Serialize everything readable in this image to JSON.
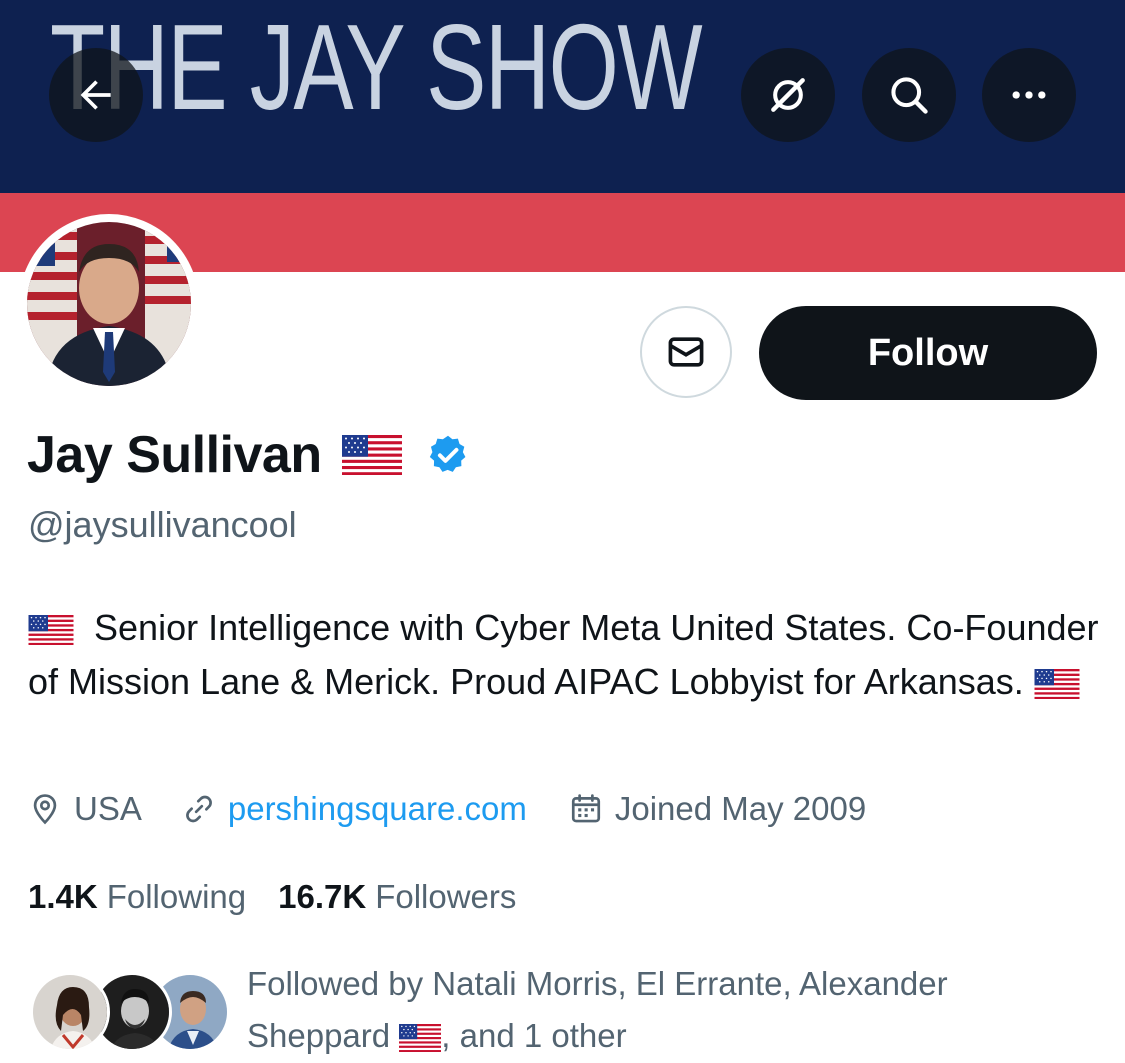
{
  "banner": {
    "text": "THE JAY SHOW",
    "colors": {
      "navy": "#0e2150",
      "red": "#dc4552",
      "text": "#c9d3e1"
    }
  },
  "header_actions": {
    "back_icon": "arrow-left-icon",
    "grok_icon": "grok-icon",
    "search_icon": "search-icon",
    "more_icon": "more-horizontal-icon"
  },
  "profile": {
    "display_name": "Jay Sullivan",
    "name_flag": "us-flag-emoji",
    "verified_icon": "verified-badge-icon",
    "handle": "@jaysullivancool",
    "bio_line1": "Senior Intelligence with Cyber Meta United States. Co-Founder of Mission Lane & Merick. Proud AIPAC Lobbyist for Arkansas.",
    "bio_flag": "us-flag-emoji"
  },
  "actions": {
    "message_icon": "envelope-icon",
    "follow_label": "Follow"
  },
  "meta": {
    "location_icon": "location-pin-icon",
    "location": "USA",
    "link_icon": "link-icon",
    "website": "pershingsquare.com",
    "calendar_icon": "calendar-icon",
    "joined": "Joined May 2009"
  },
  "stats": {
    "following_count": "1.4K",
    "following_label": "Following",
    "followers_count": "16.7K",
    "followers_label": "Followers"
  },
  "followed_by": {
    "text_before_flag": "Followed by Natali Morris, El Errante, Alexander Sheppard",
    "text_after_flag": ", and 1 other"
  },
  "colors": {
    "text_primary": "#0f1419",
    "text_secondary": "#536471",
    "link": "#1d9bf0",
    "follow_button_bg": "#0f1419",
    "verified_blue": "#1d9bf0"
  }
}
